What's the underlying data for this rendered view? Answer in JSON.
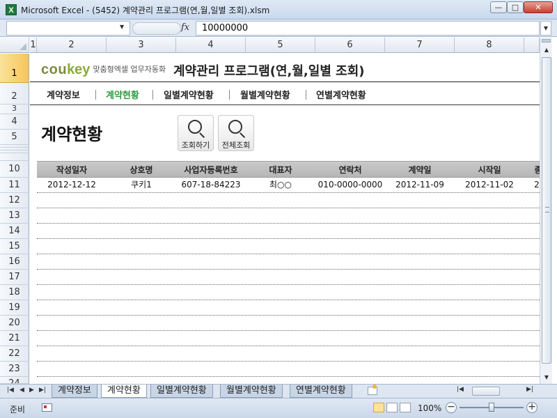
{
  "window": {
    "app_icon": "X",
    "title": "Microsoft Excel - (5452) 계약관리 프로그램(연,월,일별 조회).xlsm",
    "min_icon": "minimize-icon",
    "max_icon": "maximize-icon",
    "close_icon": "close-icon",
    "min_label": "—",
    "max_label": "□",
    "close_label": "✕"
  },
  "formula_bar": {
    "name_box": "",
    "fx": "fx",
    "value": "10000000"
  },
  "columns": [
    "1",
    "2",
    "3",
    "4",
    "5",
    "6",
    "7",
    "8"
  ],
  "rows": [
    "1",
    "2",
    "3",
    "4",
    "5",
    "10",
    "11",
    "12",
    "13",
    "14",
    "15",
    "16",
    "17",
    "18",
    "19",
    "20",
    "21",
    "22",
    "23",
    "24"
  ],
  "sheet": {
    "logo_main_a": "cou",
    "logo_main_b": "key",
    "logo_sub": "맞춤형엑셀 업무자동화",
    "program_title": "계약관리 프로그램(연,월,일별 조회)",
    "nav": [
      "계약정보",
      "계약현황",
      "일별계약현황",
      "월별계약현황",
      "연별계약현황"
    ],
    "section_title": "계약현황",
    "search_button": "조회하기",
    "all_button": "전체조회",
    "table_headers": [
      "작성일자",
      "상호명",
      "사업자등록번호",
      "대표자",
      "연락처",
      "계약일",
      "시작일",
      "종"
    ],
    "table_rows": [
      [
        "2012-12-12",
        "쿠키1",
        "607-18-84223",
        "최○○",
        "010-0000-0000",
        "2012-11-09",
        "2012-11-02",
        "2"
      ]
    ]
  },
  "tabs": [
    "계약정보",
    "계약현황",
    "일별계약현황",
    "월별계약현황",
    "연별계약현황"
  ],
  "active_tab": "계약현황",
  "status": {
    "ready": "준비",
    "zoom": "100%",
    "zoom_minus": "−",
    "zoom_plus": "+"
  },
  "colors": {
    "accent_green": "#2e9a3e",
    "selected_row_header": "#f6c55a",
    "table_header_bg": "#bfbfbf"
  }
}
